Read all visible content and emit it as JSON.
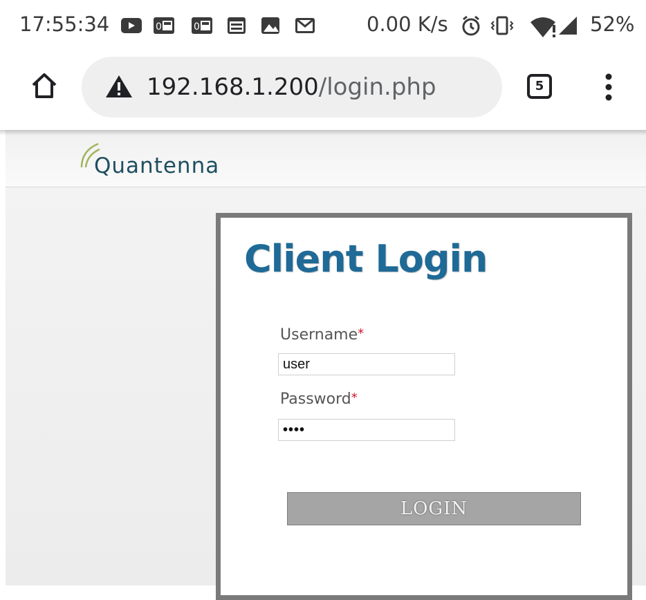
{
  "status_bar": {
    "time": "17:55:34",
    "speed": "0.00 K/s",
    "battery": "52%",
    "icons": [
      "youtube-icon",
      "app-icon",
      "app-icon",
      "calendar-icon",
      "image-icon",
      "gmail-icon",
      "alarm-icon",
      "vibrate-icon",
      "wifi-alert-icon",
      "signal-icon"
    ]
  },
  "browser": {
    "url_host": "192.168.1.200",
    "url_path": "/login.php",
    "tab_count": "5",
    "security_icon": "warning-icon"
  },
  "page": {
    "logo_text": "Quantenna",
    "title": "Client Login",
    "username_label": "Username",
    "password_label": "Password",
    "required_mark": "*",
    "username_value": "user",
    "password_value": "••••",
    "login_button": "LOGIN"
  }
}
